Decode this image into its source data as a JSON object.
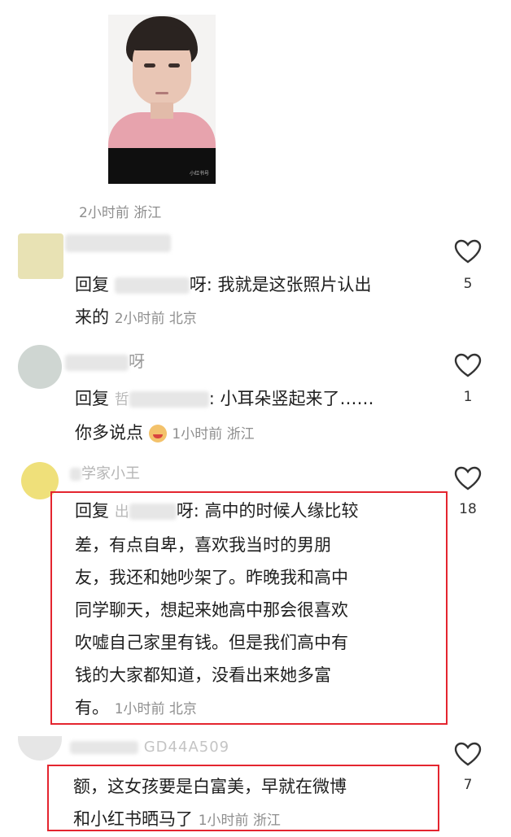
{
  "colors": {
    "accent_red": "#e4252f",
    "meta_gray": "#8e8e8e",
    "text": "#1f1f1f"
  },
  "photo": {
    "watermark": "小红书号"
  },
  "top_meta": "2小时前 浙江",
  "comments": [
    {
      "reply_prefix": "回复",
      "nick_tail": "呀",
      "text_l1": "我就是这张照片认出",
      "text_l2": "来的",
      "meta": "2小时前 北京",
      "likes": "5"
    },
    {
      "nick": "呀",
      "reply_prefix": "回复",
      "nick_head": "哲",
      "text_l1": "小耳朵竖起来了……",
      "text_l2": "你多说点",
      "meta": "1小时前 浙江",
      "likes": "1"
    },
    {
      "nick": "学家小王",
      "reply_prefix": "回复",
      "nick_head": "出",
      "nick_tail": "呀",
      "lines": [
        "高中的时候人缘比较",
        "差，有点自卑，喜欢我当时的男朋",
        "友，我还和她吵架了。昨晚我和高中",
        "同学聊天，想起来她高中那会很喜欢",
        "吹嘘自己家里有钱。但是我们高中有",
        "钱的大家都知道，没看出来她多富"
      ],
      "last_line": "有。",
      "meta": "1小时前 北京",
      "likes": "18"
    },
    {
      "nick": "GD44A509",
      "text_l1": "额，这女孩要是白富美，早就在微博",
      "text_l2": "和小红书晒马了",
      "meta": "1小时前 浙江",
      "likes": "7"
    }
  ]
}
